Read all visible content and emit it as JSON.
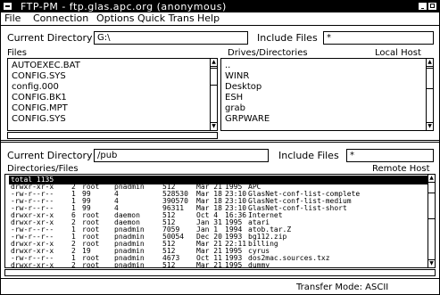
{
  "window": {
    "title": "FTP-PM - ftp.glas.apc.org (anonymous)"
  },
  "menu": [
    "File",
    "Connection",
    "Options",
    "Quick Trans",
    "Help"
  ],
  "local": {
    "current_directory_label": "Current Directory",
    "current_directory_value": "G:\\",
    "include_files_label": "Include Files",
    "include_files_value": "*",
    "files_label": "Files",
    "drives_label": "Drives/Directories",
    "host_label": "Local Host",
    "files": [
      "AUTOEXEC.BAT",
      "CONFIG.SYS",
      "config.000",
      "CONFIG.BK1",
      "CONFIG.MPT",
      "CONFIG.SYS"
    ],
    "directories": [
      "..",
      "WINR",
      "Desktop",
      "ESH",
      "grab",
      "GRPWARE"
    ]
  },
  "remote": {
    "current_directory_label": "Current Directory",
    "current_directory_value": "/pub",
    "include_files_label": "Include Files",
    "include_files_value": "*",
    "list_label": "Directories/Files",
    "host_label": "Remote Host",
    "rows": [
      {
        "perm": "total 1135",
        "links": "",
        "owner": "",
        "group": "",
        "size": "",
        "date": "",
        "time": "",
        "name": ""
      },
      {
        "perm": "drwxr-xr-x",
        "links": "2",
        "owner": "root",
        "group": "pnadmin",
        "size": "512",
        "date": "Mar 21",
        "time": "1995",
        "name": "APC"
      },
      {
        "perm": "-rw-r--r--",
        "links": "1",
        "owner": "99",
        "group": "4",
        "size": "528530",
        "date": "Mar 18",
        "time": "23:10",
        "name": "GlasNet-conf-list-complete"
      },
      {
        "perm": "-rw-r--r--",
        "links": "1",
        "owner": "99",
        "group": "4",
        "size": "390570",
        "date": "Mar 18",
        "time": "23:10",
        "name": "GlasNet-conf-list-medium"
      },
      {
        "perm": "-rw-r--r--",
        "links": "1",
        "owner": "99",
        "group": "4",
        "size": "96311",
        "date": "Mar 18",
        "time": "23:10",
        "name": "GlasNet-conf-list-short"
      },
      {
        "perm": "drwxr-xr-x",
        "links": "6",
        "owner": "root",
        "group": "daemon",
        "size": "512",
        "date": "Oct 4",
        "time": "16:36",
        "name": "Internet"
      },
      {
        "perm": "drwxr-xr-x",
        "links": "2",
        "owner": "root",
        "group": "daemon",
        "size": "512",
        "date": "Jan 31",
        "time": "1995",
        "name": "atari"
      },
      {
        "perm": "-rw-r--r--",
        "links": "1",
        "owner": "root",
        "group": "pnadmin",
        "size": "7059",
        "date": "Jan 1",
        "time": "1994",
        "name": "atob.tar.Z"
      },
      {
        "perm": "-rw-r--r--",
        "links": "1",
        "owner": "root",
        "group": "pnadmin",
        "size": "50054",
        "date": "Dec 20",
        "time": "1993",
        "name": "bg112.zip"
      },
      {
        "perm": "drwxr-xr-x",
        "links": "2",
        "owner": "root",
        "group": "pnadmin",
        "size": "512",
        "date": "Mar 21",
        "time": "22:11",
        "name": "billing"
      },
      {
        "perm": "drwxr-xr-x",
        "links": "2",
        "owner": "19",
        "group": "pnadmin",
        "size": "512",
        "date": "Mar 21",
        "time": "1995",
        "name": "cyrus"
      },
      {
        "perm": "-rw-r--r--",
        "links": "1",
        "owner": "root",
        "group": "pnadmin",
        "size": "4673",
        "date": "Oct 11",
        "time": "1993",
        "name": "dos2mac.sources.txz"
      },
      {
        "perm": "drwxr-xr-x",
        "links": "2",
        "owner": "root",
        "group": "pnadmin",
        "size": "512",
        "date": "Mar 21",
        "time": "1995",
        "name": "dummy"
      }
    ]
  },
  "status": {
    "transfer_mode": "Transfer Mode: ASCII"
  }
}
